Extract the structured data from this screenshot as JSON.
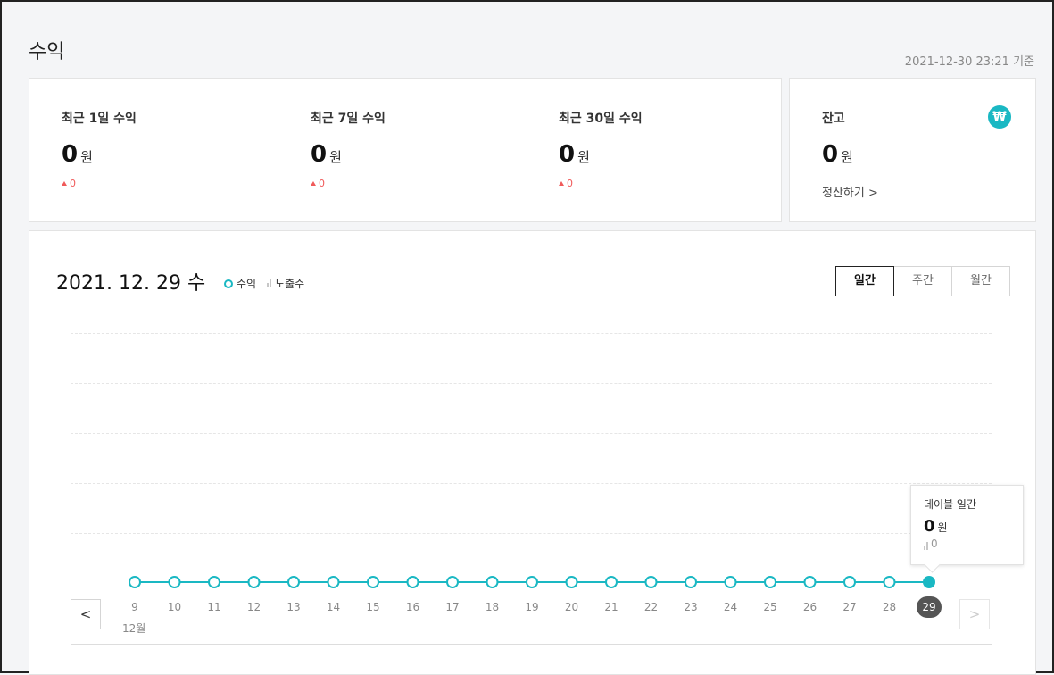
{
  "header": {
    "title": "수익",
    "timestamp": "2021-12-30 23:21 기준"
  },
  "summary": [
    {
      "label": "최근 1일 수익",
      "value": "0",
      "unit": "원",
      "change": "0"
    },
    {
      "label": "최근 7일 수익",
      "value": "0",
      "unit": "원",
      "change": "0"
    },
    {
      "label": "최근 30일 수익",
      "value": "0",
      "unit": "원",
      "change": "0"
    }
  ],
  "balance": {
    "label": "잔고",
    "value": "0",
    "unit": "원",
    "settle_label": "정산하기 >",
    "icon": "won-icon",
    "icon_glyph": "₩"
  },
  "chart_panel": {
    "date": "2021. 12. 29 수",
    "legend": {
      "revenue": "수익",
      "impressions": "노출수"
    },
    "tabs": [
      {
        "label": "일간",
        "active": true
      },
      {
        "label": "주간",
        "active": false
      },
      {
        "label": "월간",
        "active": false
      }
    ],
    "nav_prev": "<",
    "nav_next": ">",
    "month_label": "12월",
    "accent_color": "#1ab8c3"
  },
  "tooltip": {
    "title": "데이블 일간",
    "value": "0",
    "unit": "원",
    "impressions": "0"
  },
  "chart_data": {
    "type": "line",
    "x": [
      "9",
      "10",
      "11",
      "12",
      "13",
      "14",
      "15",
      "16",
      "17",
      "18",
      "19",
      "20",
      "21",
      "22",
      "23",
      "24",
      "25",
      "26",
      "27",
      "28",
      "29"
    ],
    "series": [
      {
        "name": "수익",
        "values": [
          0,
          0,
          0,
          0,
          0,
          0,
          0,
          0,
          0,
          0,
          0,
          0,
          0,
          0,
          0,
          0,
          0,
          0,
          0,
          0,
          0
        ]
      }
    ],
    "selected_index": 20,
    "grid": true
  }
}
